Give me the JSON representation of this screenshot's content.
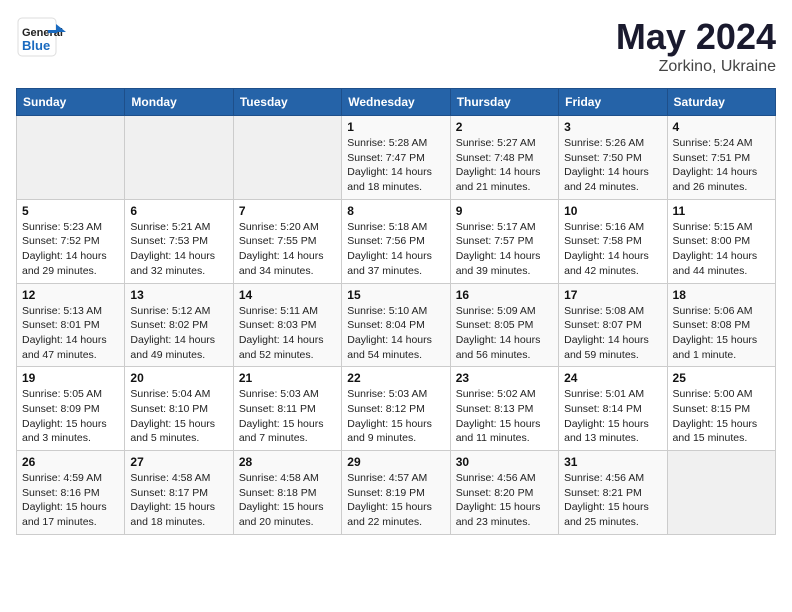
{
  "header": {
    "logo_general": "General",
    "logo_blue": "Blue",
    "month_title": "May 2024",
    "subtitle": "Zorkino, Ukraine"
  },
  "weekdays": [
    "Sunday",
    "Monday",
    "Tuesday",
    "Wednesday",
    "Thursday",
    "Friday",
    "Saturday"
  ],
  "weeks": [
    [
      {
        "day": "",
        "info": ""
      },
      {
        "day": "",
        "info": ""
      },
      {
        "day": "",
        "info": ""
      },
      {
        "day": "1",
        "info": "Sunrise: 5:28 AM\nSunset: 7:47 PM\nDaylight: 14 hours\nand 18 minutes."
      },
      {
        "day": "2",
        "info": "Sunrise: 5:27 AM\nSunset: 7:48 PM\nDaylight: 14 hours\nand 21 minutes."
      },
      {
        "day": "3",
        "info": "Sunrise: 5:26 AM\nSunset: 7:50 PM\nDaylight: 14 hours\nand 24 minutes."
      },
      {
        "day": "4",
        "info": "Sunrise: 5:24 AM\nSunset: 7:51 PM\nDaylight: 14 hours\nand 26 minutes."
      }
    ],
    [
      {
        "day": "5",
        "info": "Sunrise: 5:23 AM\nSunset: 7:52 PM\nDaylight: 14 hours\nand 29 minutes."
      },
      {
        "day": "6",
        "info": "Sunrise: 5:21 AM\nSunset: 7:53 PM\nDaylight: 14 hours\nand 32 minutes."
      },
      {
        "day": "7",
        "info": "Sunrise: 5:20 AM\nSunset: 7:55 PM\nDaylight: 14 hours\nand 34 minutes."
      },
      {
        "day": "8",
        "info": "Sunrise: 5:18 AM\nSunset: 7:56 PM\nDaylight: 14 hours\nand 37 minutes."
      },
      {
        "day": "9",
        "info": "Sunrise: 5:17 AM\nSunset: 7:57 PM\nDaylight: 14 hours\nand 39 minutes."
      },
      {
        "day": "10",
        "info": "Sunrise: 5:16 AM\nSunset: 7:58 PM\nDaylight: 14 hours\nand 42 minutes."
      },
      {
        "day": "11",
        "info": "Sunrise: 5:15 AM\nSunset: 8:00 PM\nDaylight: 14 hours\nand 44 minutes."
      }
    ],
    [
      {
        "day": "12",
        "info": "Sunrise: 5:13 AM\nSunset: 8:01 PM\nDaylight: 14 hours\nand 47 minutes."
      },
      {
        "day": "13",
        "info": "Sunrise: 5:12 AM\nSunset: 8:02 PM\nDaylight: 14 hours\nand 49 minutes."
      },
      {
        "day": "14",
        "info": "Sunrise: 5:11 AM\nSunset: 8:03 PM\nDaylight: 14 hours\nand 52 minutes."
      },
      {
        "day": "15",
        "info": "Sunrise: 5:10 AM\nSunset: 8:04 PM\nDaylight: 14 hours\nand 54 minutes."
      },
      {
        "day": "16",
        "info": "Sunrise: 5:09 AM\nSunset: 8:05 PM\nDaylight: 14 hours\nand 56 minutes."
      },
      {
        "day": "17",
        "info": "Sunrise: 5:08 AM\nSunset: 8:07 PM\nDaylight: 14 hours\nand 59 minutes."
      },
      {
        "day": "18",
        "info": "Sunrise: 5:06 AM\nSunset: 8:08 PM\nDaylight: 15 hours\nand 1 minute."
      }
    ],
    [
      {
        "day": "19",
        "info": "Sunrise: 5:05 AM\nSunset: 8:09 PM\nDaylight: 15 hours\nand 3 minutes."
      },
      {
        "day": "20",
        "info": "Sunrise: 5:04 AM\nSunset: 8:10 PM\nDaylight: 15 hours\nand 5 minutes."
      },
      {
        "day": "21",
        "info": "Sunrise: 5:03 AM\nSunset: 8:11 PM\nDaylight: 15 hours\nand 7 minutes."
      },
      {
        "day": "22",
        "info": "Sunrise: 5:03 AM\nSunset: 8:12 PM\nDaylight: 15 hours\nand 9 minutes."
      },
      {
        "day": "23",
        "info": "Sunrise: 5:02 AM\nSunset: 8:13 PM\nDaylight: 15 hours\nand 11 minutes."
      },
      {
        "day": "24",
        "info": "Sunrise: 5:01 AM\nSunset: 8:14 PM\nDaylight: 15 hours\nand 13 minutes."
      },
      {
        "day": "25",
        "info": "Sunrise: 5:00 AM\nSunset: 8:15 PM\nDaylight: 15 hours\nand 15 minutes."
      }
    ],
    [
      {
        "day": "26",
        "info": "Sunrise: 4:59 AM\nSunset: 8:16 PM\nDaylight: 15 hours\nand 17 minutes."
      },
      {
        "day": "27",
        "info": "Sunrise: 4:58 AM\nSunset: 8:17 PM\nDaylight: 15 hours\nand 18 minutes."
      },
      {
        "day": "28",
        "info": "Sunrise: 4:58 AM\nSunset: 8:18 PM\nDaylight: 15 hours\nand 20 minutes."
      },
      {
        "day": "29",
        "info": "Sunrise: 4:57 AM\nSunset: 8:19 PM\nDaylight: 15 hours\nand 22 minutes."
      },
      {
        "day": "30",
        "info": "Sunrise: 4:56 AM\nSunset: 8:20 PM\nDaylight: 15 hours\nand 23 minutes."
      },
      {
        "day": "31",
        "info": "Sunrise: 4:56 AM\nSunset: 8:21 PM\nDaylight: 15 hours\nand 25 minutes."
      },
      {
        "day": "",
        "info": ""
      }
    ]
  ]
}
